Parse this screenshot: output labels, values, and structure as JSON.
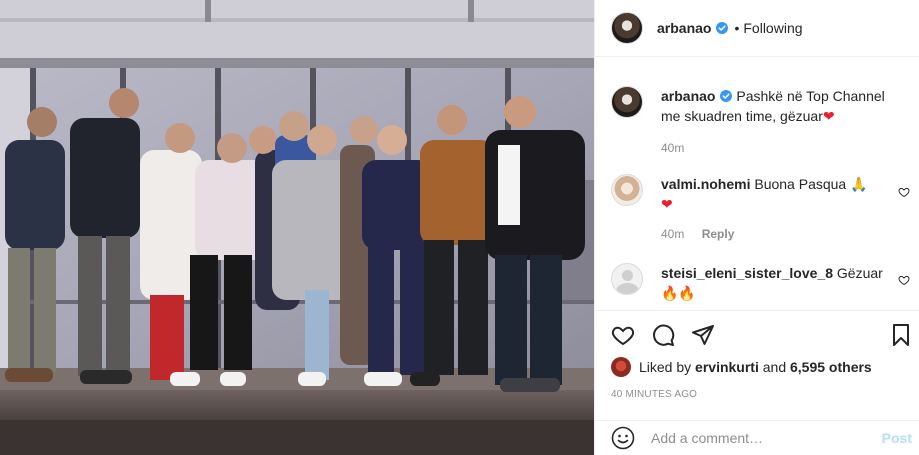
{
  "photo": {
    "alt": "Group photo"
  },
  "header": {
    "username": "arbanao",
    "separator": "•",
    "follow_state": "Following"
  },
  "caption": {
    "username": "arbanao",
    "text": "Pashkë në Top Channel me skuadren time, gëzuar",
    "emoji": "❤",
    "time": "40m"
  },
  "comments": [
    {
      "username": "valmi.nohemi",
      "text": "Buona Pasqua",
      "emoji_line": "❤",
      "time": "40m",
      "reply": "Reply"
    },
    {
      "username": "steisi_eleni_sister_love_8",
      "text": "Gëzuar",
      "emoji_line": "🔥🔥"
    }
  ],
  "likes": {
    "prefix": "Liked by",
    "user": "ervinkurti",
    "and": "and",
    "others": "6,595 others"
  },
  "timestamp": "40 MINUTES AGO",
  "add_comment": {
    "placeholder": "Add a comment…",
    "post": "Post"
  },
  "colors": {
    "verified": "#3897f0",
    "heart": "#ed1c2e",
    "post_disabled": "#b2dffc",
    "muted": "#8e8e8e"
  },
  "icons": [
    "heart-icon",
    "comment-icon",
    "share-icon",
    "bookmark-icon",
    "smiley-icon",
    "verified-badge-icon"
  ]
}
